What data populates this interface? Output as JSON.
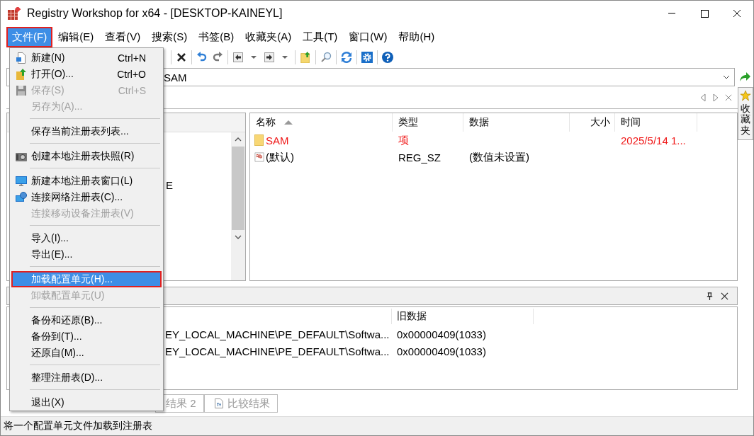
{
  "window": {
    "title": "Registry Workshop for x64 - [DESKTOP-KAINEYL]"
  },
  "menu_bar": [
    {
      "label": "文件(F)",
      "selected": true
    },
    {
      "label": "编辑(E)",
      "selected": false
    },
    {
      "label": "查看(V)",
      "selected": false
    },
    {
      "label": "搜索(S)",
      "selected": false
    },
    {
      "label": "书签(B)",
      "selected": false
    },
    {
      "label": "收藏夹(A)",
      "selected": false
    },
    {
      "label": "工具(T)",
      "selected": false
    },
    {
      "label": "窗口(W)",
      "selected": false
    },
    {
      "label": "帮助(H)",
      "selected": false
    }
  ],
  "file_menu": [
    {
      "kind": "item",
      "label": "新建(N)",
      "shortcut": "Ctrl+N",
      "disabled": false,
      "selected": false
    },
    {
      "kind": "item",
      "label": "打开(O)...",
      "shortcut": "Ctrl+O",
      "disabled": false,
      "selected": false
    },
    {
      "kind": "item",
      "label": "保存(S)",
      "shortcut": "Ctrl+S",
      "disabled": true,
      "selected": false
    },
    {
      "kind": "item",
      "label": "另存为(A)...",
      "disabled": true,
      "selected": false
    },
    {
      "kind": "separator"
    },
    {
      "kind": "item",
      "label": "保存当前注册表列表...",
      "disabled": false,
      "selected": false
    },
    {
      "kind": "separator"
    },
    {
      "kind": "item",
      "label": "创建本地注册表快照(R)",
      "disabled": false,
      "selected": false
    },
    {
      "kind": "separator"
    },
    {
      "kind": "item",
      "label": "新建本地注册表窗口(L)",
      "disabled": false,
      "selected": false
    },
    {
      "kind": "item",
      "label": "连接网络注册表(C)...",
      "disabled": false,
      "selected": false
    },
    {
      "kind": "item",
      "label": "连接移动设备注册表(V)",
      "disabled": true,
      "selected": false
    },
    {
      "kind": "separator"
    },
    {
      "kind": "item",
      "label": "导入(I)...",
      "disabled": false,
      "selected": false
    },
    {
      "kind": "item",
      "label": "导出(E)...",
      "disabled": false,
      "selected": false
    },
    {
      "kind": "separator"
    },
    {
      "kind": "item",
      "label": "加载配置单元(H)...",
      "disabled": false,
      "selected": true
    },
    {
      "kind": "item",
      "label": "卸载配置单元(U)",
      "disabled": true,
      "selected": false
    },
    {
      "kind": "separator"
    },
    {
      "kind": "item",
      "label": "备份和还原(B)...",
      "disabled": false,
      "selected": false
    },
    {
      "kind": "item",
      "label": "备份到(T)...",
      "disabled": false,
      "selected": false
    },
    {
      "kind": "item",
      "label": "还原自(M)...",
      "disabled": false,
      "selected": false
    },
    {
      "kind": "separator"
    },
    {
      "kind": "item",
      "label": "整理注册表(D)...",
      "disabled": false,
      "selected": false
    },
    {
      "kind": "separator"
    },
    {
      "kind": "item",
      "label": "退出(X)",
      "disabled": false,
      "selected": false
    }
  ],
  "address_bar": {
    "value": "SAM"
  },
  "favorites_tab": {
    "label": "收藏夹"
  },
  "tree": {
    "rows": [
      {
        "label": "E"
      }
    ]
  },
  "value_list": {
    "columns": [
      {
        "label": "名称",
        "sorted": true
      },
      {
        "label": "类型",
        "sorted": false
      },
      {
        "label": "数据",
        "sorted": false
      },
      {
        "label": "大小",
        "sorted": false
      },
      {
        "label": "时间",
        "sorted": false
      }
    ],
    "rows": [
      {
        "kind": "key",
        "name": "SAM",
        "type": "项",
        "time": "2025/5/14 1..."
      },
      {
        "kind": "string",
        "name": "(默认)",
        "type": "REG_SZ",
        "data": "(数值未设置)"
      }
    ]
  },
  "history": {
    "columns": [
      "旧数据"
    ],
    "rows": [
      {
        "path": "EY_LOCAL_MACHINE\\PE_DEFAULT\\Softwa...",
        "old_data": "0x00000409(1033)"
      },
      {
        "path": "EY_LOCAL_MACHINE\\PE_DEFAULT\\Softwa...",
        "old_data": "0x00000409(1033)"
      }
    ]
  },
  "bottom_tabs": [
    {
      "label": "结果 2",
      "selected": false
    },
    {
      "label": "比较结果",
      "selected": false
    }
  ],
  "status_bar": "将一个配置单元文件加载到注册表"
}
